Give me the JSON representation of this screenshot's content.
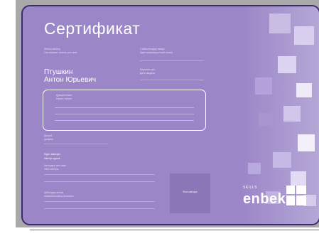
{
  "certificate": {
    "title": "Сертификат",
    "recipient_label": "Өтініш иесінің\nСертификат иесінің аты-жөні",
    "id_label": "Сәйкестендіру нөмірі\nИдентификационный номер",
    "date_label": "Берілген күні\nДата выдачи",
    "recipient_name_line1": "Птушкин",
    "recipient_name_line2": "Антон Юрьевич",
    "competency_label": "Құзыреттілікті\nтанып / өткен",
    "level_label": "Деңгей\nуровень",
    "course_author_label": "Курс авторы",
    "course_author_value": "Автор курса",
    "detail_label": "Автордың аты-жөні\nФИО автора",
    "signature_label": "Қабылдау аталы\nкомиссиясының хатшысы",
    "stamp_text": "Фото автора",
    "logo_small": "SKILLS",
    "logo_big": "enbek"
  }
}
